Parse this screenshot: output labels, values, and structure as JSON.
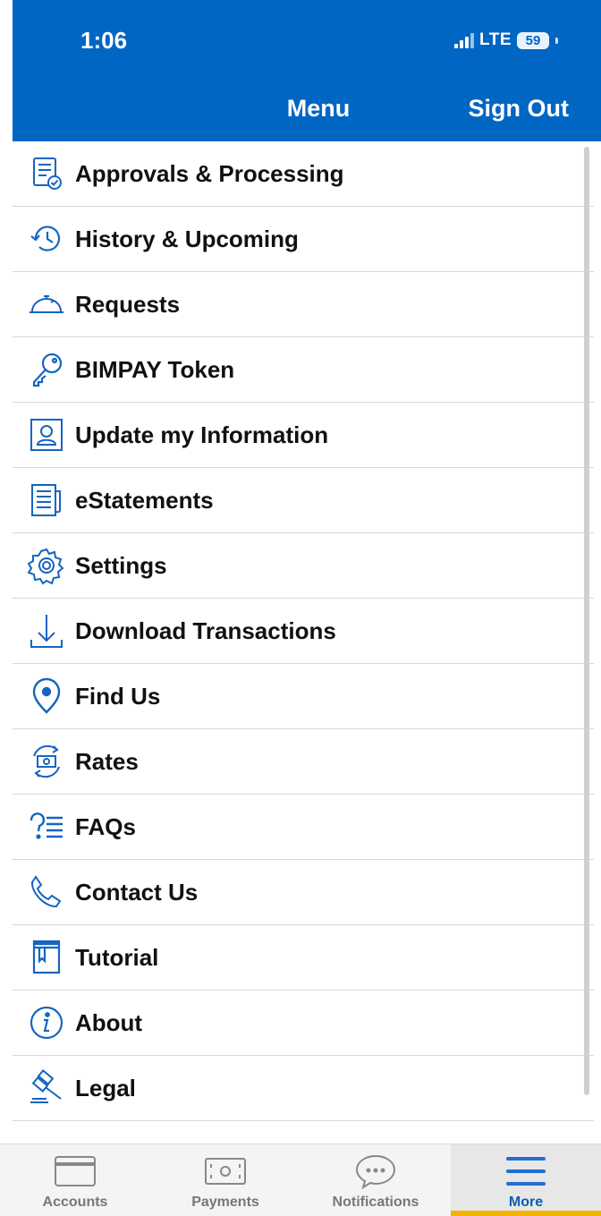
{
  "status_bar": {
    "time": "1:06",
    "network": "LTE",
    "battery": "59"
  },
  "header": {
    "title": "Menu",
    "sign_out_label": "Sign Out"
  },
  "menu": {
    "items": [
      {
        "label": "Approvals & Processing",
        "icon": "approvals-icon"
      },
      {
        "label": "History & Upcoming",
        "icon": "history-icon"
      },
      {
        "label": "Requests",
        "icon": "service-bell-icon"
      },
      {
        "label": "BIMPAY Token",
        "icon": "key-icon"
      },
      {
        "label": "Update my Information",
        "icon": "user-profile-icon"
      },
      {
        "label": "eStatements",
        "icon": "document-icon"
      },
      {
        "label": "Settings",
        "icon": "gear-icon"
      },
      {
        "label": "Download Transactions",
        "icon": "download-icon"
      },
      {
        "label": "Find Us",
        "icon": "location-pin-icon"
      },
      {
        "label": "Rates",
        "icon": "exchange-rates-icon"
      },
      {
        "label": "FAQs",
        "icon": "faq-icon"
      },
      {
        "label": "Contact Us",
        "icon": "phone-icon"
      },
      {
        "label": "Tutorial",
        "icon": "book-icon"
      },
      {
        "label": "About",
        "icon": "info-icon"
      },
      {
        "label": "Legal",
        "icon": "gavel-icon"
      }
    ]
  },
  "tabbar": {
    "tabs": [
      {
        "label": "Accounts",
        "icon": "card-icon",
        "active": false
      },
      {
        "label": "Payments",
        "icon": "cash-icon",
        "active": false
      },
      {
        "label": "Notifications",
        "icon": "chat-bubble-icon",
        "active": false
      },
      {
        "label": "More",
        "icon": "hamburger-icon",
        "active": true
      }
    ]
  },
  "colors": {
    "brand_blue": "#0066c4",
    "icon_blue": "#1565c0",
    "active_indicator": "#f3b300"
  }
}
